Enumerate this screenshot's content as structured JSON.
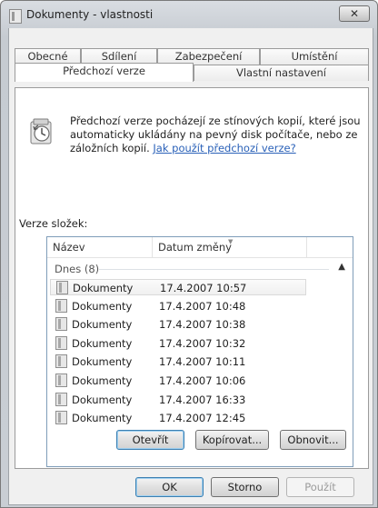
{
  "window": {
    "title": "Dokumenty - vlastnosti",
    "close_glyph": "✕"
  },
  "tabs_row1": [
    "Obecné",
    "Sdílení",
    "Zabezpečení",
    "Umístění"
  ],
  "tabs_row2": [
    "Předchozí verze",
    "Vlastní nastavení"
  ],
  "info": {
    "text": "Předchozí verze pocházejí ze stínových kopií, které jsou automaticky ukládány na pevný disk počítače, nebo ze záložních kopií. ",
    "link": "Jak použít předchozí verze?"
  },
  "versions_label": "Verze složek:",
  "list": {
    "columns": [
      "Název",
      "Datum změny"
    ],
    "group_label": "Dnes (8)",
    "rows": [
      {
        "name": "Dokumenty",
        "date": "17.4.2007 10:57"
      },
      {
        "name": "Dokumenty",
        "date": "17.4.2007 10:48"
      },
      {
        "name": "Dokumenty",
        "date": "17.4.2007 10:38"
      },
      {
        "name": "Dokumenty",
        "date": "17.4.2007 10:32"
      },
      {
        "name": "Dokumenty",
        "date": "17.4.2007 10:11"
      },
      {
        "name": "Dokumenty",
        "date": "17.4.2007 10:06"
      },
      {
        "name": "Dokumenty",
        "date": "17.4.2007 16:33"
      },
      {
        "name": "Dokumenty",
        "date": "17.4.2007 12:45"
      }
    ]
  },
  "buttons": {
    "open": "Otevřít",
    "copy": "Kopírovat...",
    "restore": "Obnovit...",
    "ok": "OK",
    "cancel": "Storno",
    "apply": "Použít"
  },
  "icons": {
    "window": "folder-icon",
    "close": "close-icon",
    "info": "previous-versions-icon",
    "row": "folder-icon"
  }
}
